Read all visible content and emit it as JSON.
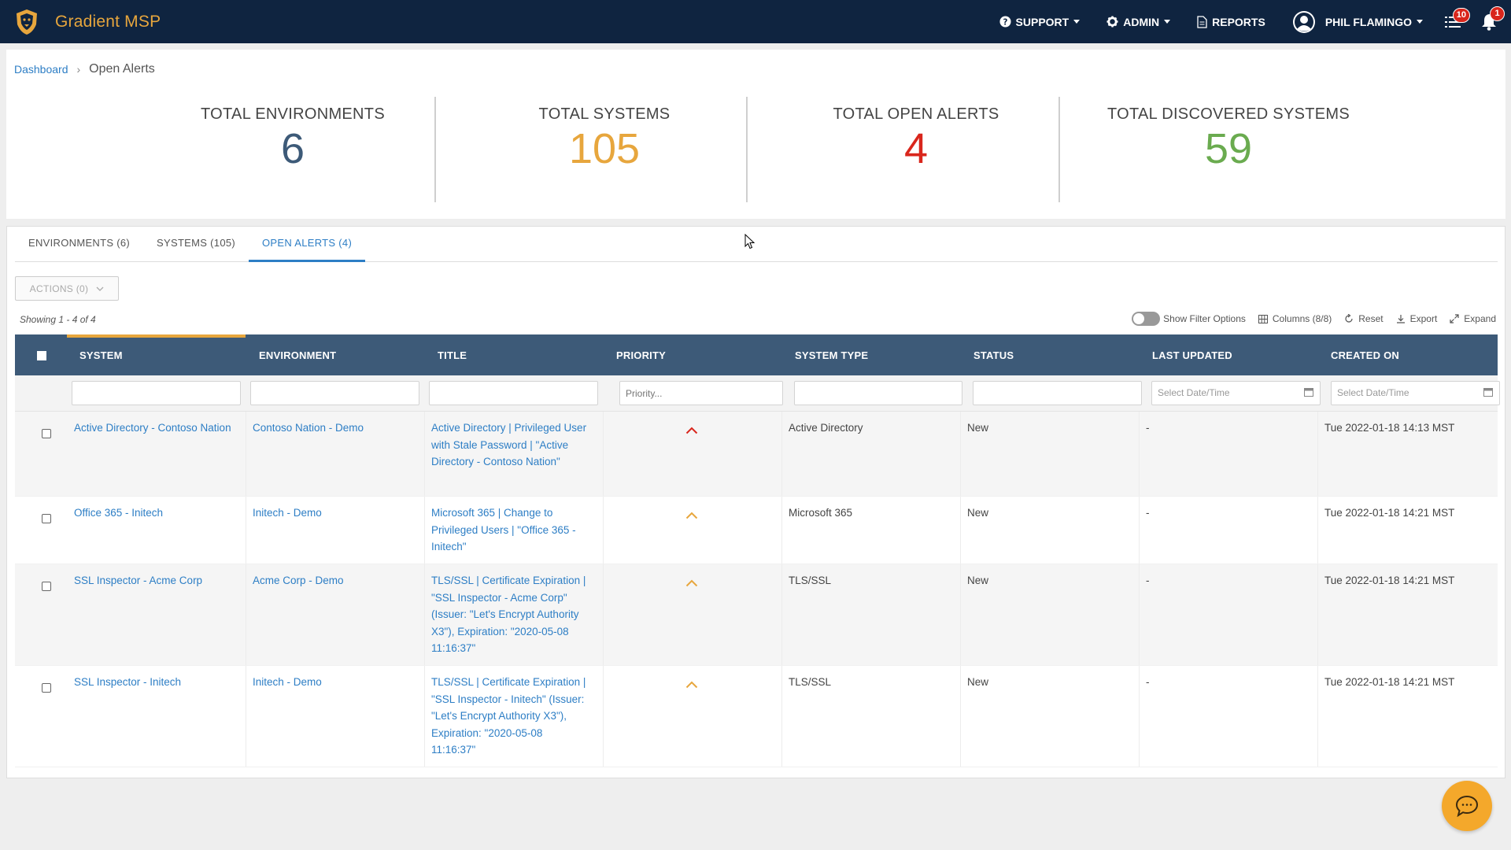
{
  "app": {
    "name": "Gradient MSP"
  },
  "nav": {
    "support": "SUPPORT",
    "admin": "ADMIN",
    "reports": "REPORTS",
    "user": "PHIL FLAMINGO",
    "tasks_badge": "10",
    "notifications_badge": "1"
  },
  "breadcrumb": {
    "root": "Dashboard",
    "current": "Open Alerts"
  },
  "stats": [
    {
      "label": "TOTAL ENVIRONMENTS",
      "value": "6",
      "color": "#3d5a78"
    },
    {
      "label": "TOTAL SYSTEMS",
      "value": "105",
      "color": "#e7a63d"
    },
    {
      "label": "TOTAL OPEN ALERTS",
      "value": "4",
      "color": "#d9261c"
    },
    {
      "label": "TOTAL DISCOVERED SYSTEMS",
      "value": "59",
      "color": "#6aab4f"
    }
  ],
  "tabs": [
    {
      "label": "ENVIRONMENTS (6)",
      "active": false
    },
    {
      "label": "SYSTEMS (105)",
      "active": false
    },
    {
      "label": "OPEN ALERTS (4)",
      "active": true
    }
  ],
  "actions_label": "ACTIONS (0)",
  "showing": "Showing 1 - 4 of 4",
  "toolbar": {
    "filter_toggle": "Show Filter Options",
    "columns": "Columns (8/8)",
    "reset": "Reset",
    "export": "Export",
    "expand": "Expand"
  },
  "table": {
    "columns": [
      "SYSTEM",
      "ENVIRONMENT",
      "TITLE",
      "PRIORITY",
      "SYSTEM TYPE",
      "STATUS",
      "LAST UPDATED",
      "CREATED ON"
    ],
    "filters": {
      "priority_placeholder": "Priority...",
      "last_updated_placeholder": "Select Date/Time",
      "created_on_placeholder": "Select Date/Time"
    },
    "rows": [
      {
        "system": "Active Directory - Contoso Nation",
        "environment": "Contoso Nation - Demo",
        "title": "Active Directory | Privileged User with Stale Password | \"Active Directory - Contoso Nation\"",
        "priority": "high",
        "priority_color": "#d9261c",
        "system_type": "Active Directory",
        "status": "New",
        "last_updated": "-",
        "created_on": "Tue 2022-01-18 14:13 MST"
      },
      {
        "system": "Office 365 - Initech",
        "environment": "Initech - Demo",
        "title": "Microsoft 365 | Change to Privileged Users | \"Office 365 - Initech\"",
        "priority": "medium",
        "priority_color": "#e7a63d",
        "system_type": "Microsoft 365",
        "status": "New",
        "last_updated": "-",
        "created_on": "Tue 2022-01-18 14:21 MST"
      },
      {
        "system": "SSL Inspector - Acme Corp",
        "environment": "Acme Corp - Demo",
        "title": "TLS/SSL | Certificate Expiration | \"SSL Inspector - Acme Corp\" (Issuer: \"Let's Encrypt Authority X3\"), Expiration: \"2020-05-08 11:16:37\"",
        "priority": "medium",
        "priority_color": "#e7a63d",
        "system_type": "TLS/SSL",
        "status": "New",
        "last_updated": "-",
        "created_on": "Tue 2022-01-18 14:21 MST"
      },
      {
        "system": "SSL Inspector - Initech",
        "environment": "Initech - Demo",
        "title": "TLS/SSL | Certificate Expiration | \"SSL Inspector - Initech\" (Issuer: \"Let's Encrypt Authority X3\"), Expiration: \"2020-05-08 11:16:37\"",
        "priority": "medium",
        "priority_color": "#e7a63d",
        "system_type": "TLS/SSL",
        "status": "New",
        "last_updated": "-",
        "created_on": "Tue 2022-01-18 14:21 MST"
      }
    ]
  },
  "colors": {
    "nav_bg": "#0f2440",
    "brand": "#e7a63d",
    "link": "#2d7ec5",
    "header_bg": "#3d5a78",
    "fab": "#f4a82b"
  }
}
